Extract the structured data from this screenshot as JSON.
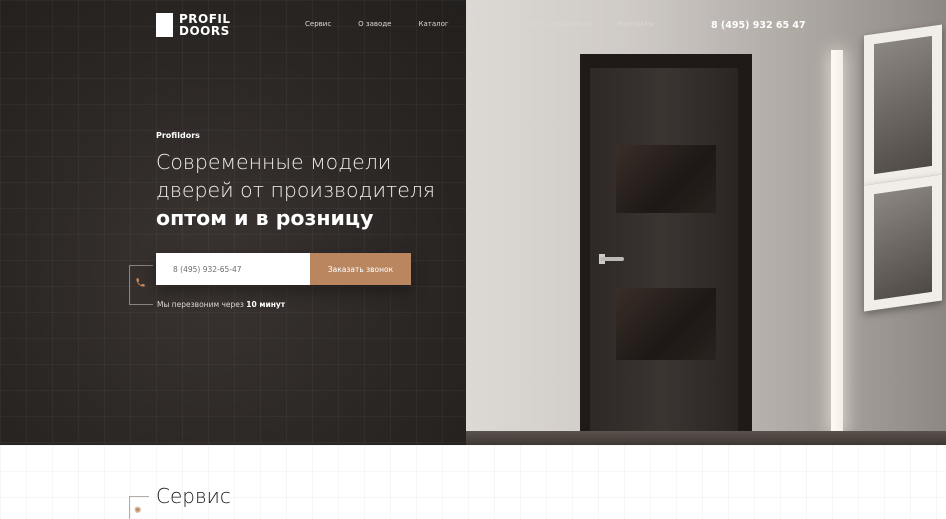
{
  "header": {
    "logo": {
      "line1": "PROFIL",
      "line2": "DOORS"
    },
    "nav": [
      {
        "label": "Сервис"
      },
      {
        "label": "О заводе"
      },
      {
        "label": "Каталог"
      },
      {
        "label": "Отзывы"
      },
      {
        "label": "Для дизайнеров"
      },
      {
        "label": "Контакты"
      }
    ],
    "phone": "8 (495) 932 65 47"
  },
  "hero": {
    "eyebrow": "Profildors",
    "title_line1": "Современные модели",
    "title_line2": "дверей от производителя",
    "title_bold": "оптом и в розницу",
    "form": {
      "phone_placeholder": "8 (495) 932-65-47",
      "button_label": "Заказать звонок"
    },
    "callback_note_prefix": "Мы перезвоним через ",
    "callback_note_bold": "10 минут",
    "phone_icon": "phone-icon"
  },
  "services": {
    "title": "Сервис",
    "icon": "service-icon"
  },
  "colors": {
    "accent": "#b98660",
    "dark_bg": "#2a2624"
  }
}
